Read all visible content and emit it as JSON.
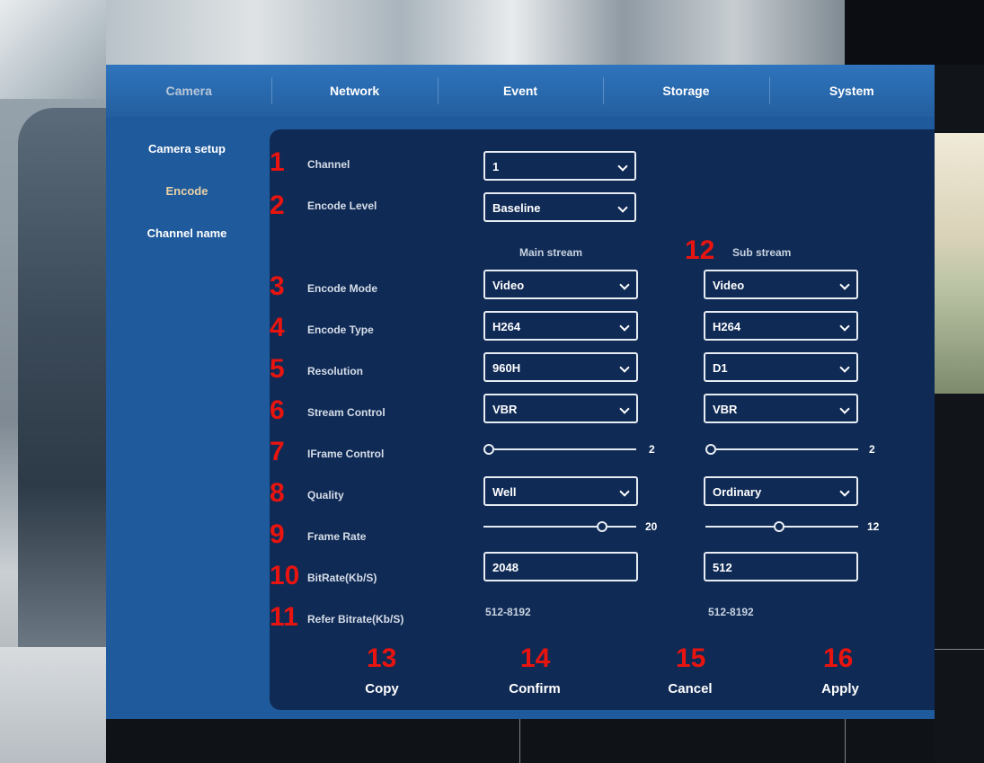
{
  "tabs": [
    "Camera",
    "Network",
    "Event",
    "Storage",
    "System"
  ],
  "active_tab": "Camera",
  "sidebar": {
    "items": [
      "Camera setup",
      "Encode",
      "Channel name"
    ],
    "active": "Encode"
  },
  "annotations": [
    "1",
    "2",
    "3",
    "4",
    "5",
    "6",
    "7",
    "8",
    "9",
    "10",
    "11",
    "12",
    "13",
    "14",
    "15",
    "16"
  ],
  "labels": {
    "channel": "Channel",
    "encode_level": "Encode Level",
    "encode_mode": "Encode Mode",
    "encode_type": "Encode Type",
    "resolution": "Resolution",
    "stream_control": "Stream Control",
    "iframe_control": "IFrame Control",
    "quality": "Quality",
    "frame_rate": "Frame Rate",
    "bitrate": "BitRate(Kb/S)",
    "refer_bitrate": "Refer Bitrate(Kb/S)"
  },
  "values": {
    "channel": "1",
    "encode_level": "Baseline"
  },
  "streams": {
    "main": {
      "heading": "Main stream",
      "encode_mode": "Video",
      "encode_type": "H264",
      "resolution": "960H",
      "stream_control": "VBR",
      "iframe_control": 2,
      "quality": "Well",
      "frame_rate": 20,
      "bitrate": "2048",
      "refer_bitrate": "512-8192"
    },
    "sub": {
      "heading": "Sub stream",
      "encode_mode": "Video",
      "encode_type": "H264",
      "resolution": "D1",
      "stream_control": "VBR",
      "iframe_control": 2,
      "quality": "Ordinary",
      "frame_rate": 12,
      "bitrate": "512",
      "refer_bitrate": "512-8192"
    }
  },
  "slider_levels": {
    "main_iframe": 0.0,
    "sub_iframe": 0.0,
    "main_frame_rate": 0.8,
    "sub_frame_rate": 0.48
  },
  "buttons": {
    "copy": "Copy",
    "confirm": "Confirm",
    "cancel": "Cancel",
    "apply": "Apply"
  },
  "colors": {
    "dialog": "#1f5a9c",
    "panel": "#0f2a55",
    "annotation": "#e8140f",
    "active_sidebar": "#e8d2a6"
  }
}
